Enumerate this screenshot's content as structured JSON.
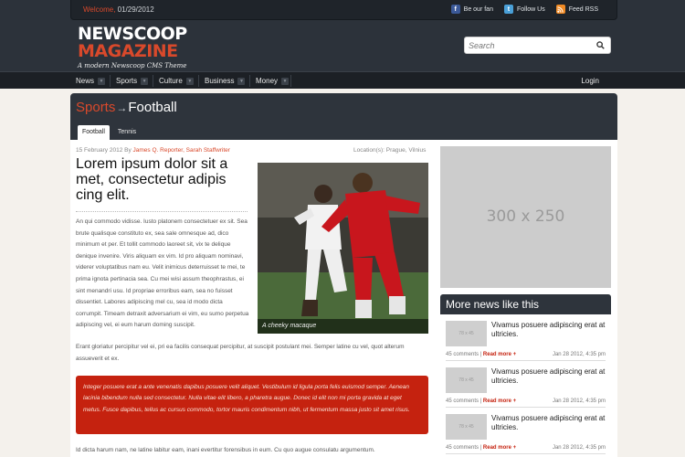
{
  "topbar": {
    "welcome_label": "Welcome,",
    "date": "01/29/2012",
    "social": [
      {
        "label": "Be our fan",
        "icon": "facebook-icon"
      },
      {
        "label": "Follow Us",
        "icon": "twitter-icon"
      },
      {
        "label": "Feed RSS",
        "icon": "rss-icon"
      }
    ]
  },
  "logo": {
    "line1": "NEWSCOOP",
    "line2": "MAGAZINE",
    "tagline": "A modern Newscoop CMS Theme"
  },
  "search": {
    "placeholder": "Search",
    "icon": "search-icon"
  },
  "nav": {
    "items": [
      {
        "label": "News"
      },
      {
        "label": "Sports"
      },
      {
        "label": "Culture"
      },
      {
        "label": "Business"
      },
      {
        "label": "Money"
      }
    ],
    "login": "Login"
  },
  "section": {
    "breadcrumb_section": "Sports",
    "breadcrumb_arrow": "→",
    "breadcrumb_page": "Football",
    "tabs": [
      {
        "label": "Football",
        "active": true
      },
      {
        "label": "Tennis",
        "active": false
      }
    ]
  },
  "article": {
    "date_by": "15 February 2012 By",
    "authors": "James Q. Reporter, Sarah Staffwriter",
    "location": "Location(s): Prague, Vilnius",
    "headline": "Lorem ipsum dolor sit a met, consectetur adipis cing elit.",
    "body1": "An qui commodo vidisse. Iusto platonem consectetuer ex sit. Sea brute qualisque constituto ex, sea sale omnesque ad, dico minimum et per. Et tollit commodo laoreet sit, vix te delique denique invenire. Viris aliquam ex vim. Id pro aliquam nominavi, viderer voluptatibus nam eu. Velit inimicus deterruisset te mei, te prima ignota pertinacia sea. Cu mei wisi assum theophrastus, ei sint menandri usu. Id propriae erroribus eam, sea no fuisset dissentiet. Labores adipiscing mel cu, sea id modo dicta corrumpit. Timeam detraxit adversarium ei vim, eu sumo perpetua adipiscing vel, ei eum harum doming suscipit.",
    "body2": "Erant gloriatur percipitur vel ei, pri ea facilis consequat percipitur, at suscipit postulant mei. Semper latine cu vel, quot alterum assueverit et ex.",
    "photo_caption": "A cheeky macaque",
    "quote": "Integer posuere erat a ante venenatis dapibus posuere velit aliquet. Vestibulum id ligula porta felis euismod semper. Aenean lacinia bibendum nulla sed consectetur. Nulla vitae elit libero, a pharetra augue. Donec id elit non mi porta gravida at eget metus. Fusce dapibus, tellus ac cursus commodo, tortor mauris condimentum nibh, ut fermentum massa justo sit amet risus.",
    "body3": "Id dicta harum nam, ne latine labitur eam, inani evertitur forensibus in eum. Cu quo augue consulatu argumentum."
  },
  "sidebar": {
    "ad_label": "300 x 250",
    "more_title": "More news like this",
    "news": [
      {
        "thumb": "78 x 45",
        "title": "Vivamus posuere adipiscing erat at ultricies.",
        "comments": "45 comments |",
        "read_more": "Read more +",
        "date": "Jan 28 2012, 4:35 pm"
      },
      {
        "thumb": "78 x 45",
        "title": "Vivamus posuere adipiscing erat at ultricies.",
        "comments": "45 comments |",
        "read_more": "Read more +",
        "date": "Jan 28 2012, 4:35 pm"
      },
      {
        "thumb": "78 x 45",
        "title": "Vivamus posuere adipiscing erat at ultricies.",
        "comments": "45 comments |",
        "read_more": "Read more +",
        "date": "Jan 28 2012, 4:35 pm"
      }
    ]
  }
}
